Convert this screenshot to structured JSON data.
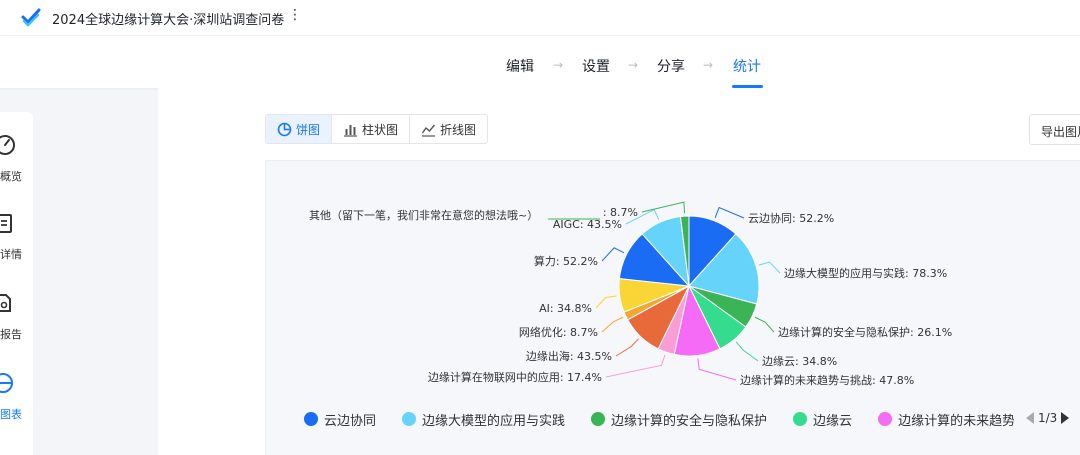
{
  "header": {
    "title": "2024全球边缘计算大会·深圳站调查问卷",
    "more_icon": "more-vertical-icon"
  },
  "steps": [
    {
      "label": "编辑"
    },
    {
      "label": "设置"
    },
    {
      "label": "分享"
    },
    {
      "label": "统计",
      "active": true
    }
  ],
  "sidebar": {
    "items": [
      {
        "label": "概览",
        "icon": "dashboard-icon"
      },
      {
        "label": "详情",
        "icon": "clipboard-icon"
      },
      {
        "label": "报告",
        "icon": "report-icon"
      },
      {
        "label": "图表",
        "icon": "chart-icon",
        "active": true
      }
    ]
  },
  "chart_tabs": [
    {
      "label": "饼图",
      "icon": "pie-icon",
      "active": true
    },
    {
      "label": "柱状图",
      "icon": "bar-chart-icon"
    },
    {
      "label": "折线图",
      "icon": "line-chart-icon"
    }
  ],
  "export_label": "导出图片",
  "colors": {
    "accent": "#1677ff"
  },
  "chart_data": {
    "type": "pie",
    "slices": [
      {
        "name": "云边协同",
        "value": 52.2,
        "color": "#1a6cf5"
      },
      {
        "name": "边缘大模型的应用与实践",
        "value": 78.3,
        "color": "#66d4fa"
      },
      {
        "name": "边缘计算的安全与隐私保护",
        "value": 26.1,
        "color": "#3ab455"
      },
      {
        "name": "边缘云",
        "value": 34.8,
        "color": "#35dc8e"
      },
      {
        "name": "边缘计算的未来趋势与挑战",
        "value": 47.8,
        "color": "#f66bf6"
      },
      {
        "name": "边缘计算在物联网中的应用",
        "value": 17.4,
        "color": "#f99dd6"
      },
      {
        "name": "边缘出海",
        "value": 43.5,
        "color": "#e8693a"
      },
      {
        "name": "网络优化",
        "value": 8.7,
        "color": "#f4a730"
      },
      {
        "name": "AI",
        "value": 34.8,
        "color": "#f9d536"
      },
      {
        "name": "算力",
        "value": 52.2,
        "color": "#1a6cf5"
      },
      {
        "name": "AIGC",
        "value": 43.5,
        "color": "#66d4fa"
      },
      {
        "name": "其他（留下一笔，我们非常在意您的想法哦~）",
        "value": 8.7,
        "color": "#3ab455"
      }
    ],
    "labels": [
      "云边协同: 52.2%",
      "边缘大模型的应用与实践: 78.3%",
      "边缘计算的安全与隐私保护: 26.1%",
      "边缘云: 34.8%",
      "边缘计算的未来趋势与挑战: 47.8%",
      "边缘计算在物联网中的应用: 17.4%",
      "边缘出海: 43.5%",
      "网络优化: 8.7%",
      "AI: 34.8%",
      "算力: 52.2%",
      "AIGC: 43.5%",
      ": 8.7%"
    ],
    "legend": {
      "items": [
        "云边协同",
        "边缘大模型的应用与实践",
        "边缘计算的安全与隐私保护",
        "边缘云",
        "边缘计算的未来趋势与挑战"
      ],
      "page": "1/3",
      "placement": "bottom"
    }
  }
}
